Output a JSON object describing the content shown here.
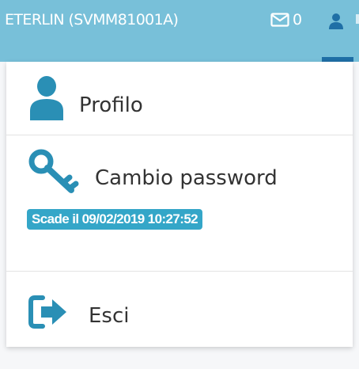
{
  "header": {
    "user_label": "ETERLIN (SVMM81001A)",
    "mail_count": "0",
    "mail_icon": "envelope-icon",
    "user_icon": "user-icon",
    "background": "#78c0d9"
  },
  "menu": {
    "items": [
      {
        "label": "Profilo",
        "icon": "user-icon"
      },
      {
        "label": "Cambio password",
        "icon": "key-icon",
        "badge": "Scade il 09/02/2019 10:27:52"
      },
      {
        "label": "Esci",
        "icon": "sign-out-icon"
      }
    ],
    "icon_color": "#2a8fb5",
    "badge_color": "#34a6c8"
  }
}
